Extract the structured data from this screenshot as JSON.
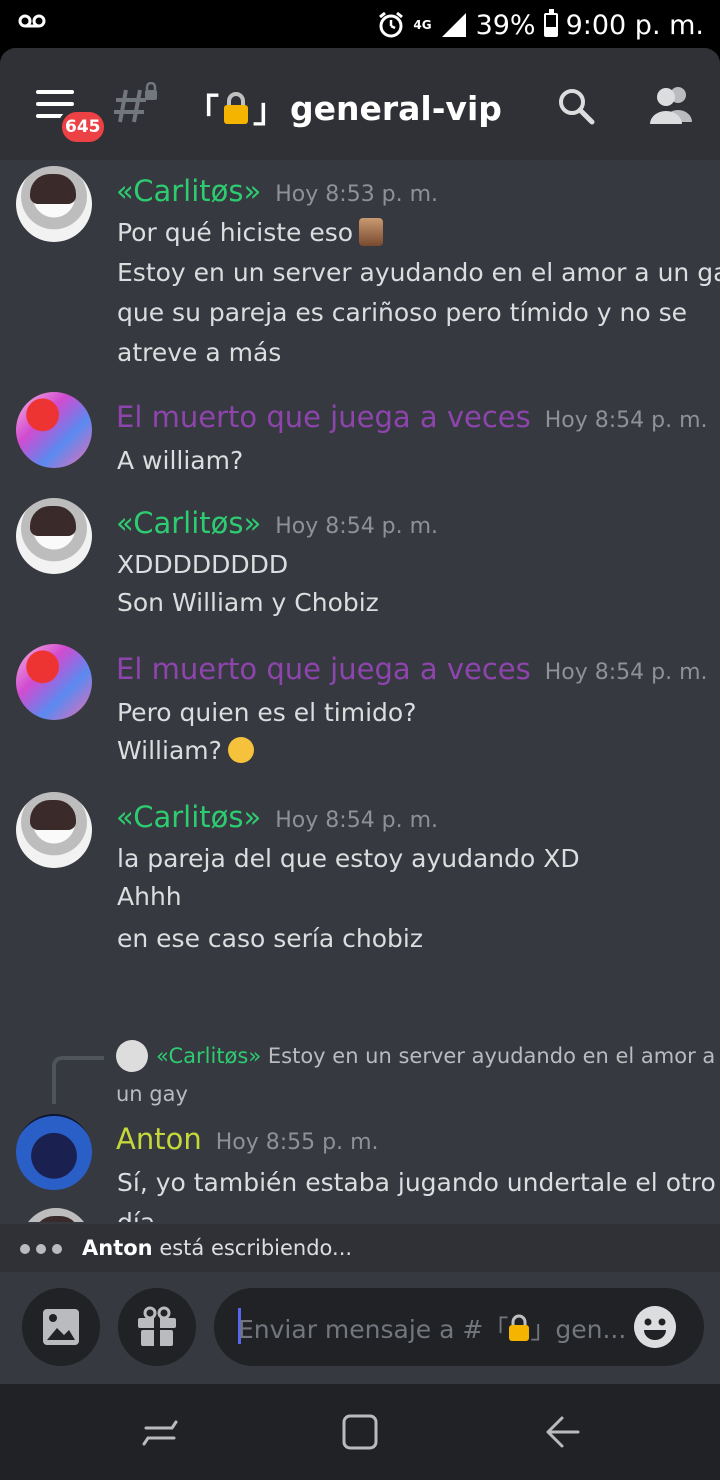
{
  "status": {
    "network": "4G",
    "battery": "39%",
    "time": "9:00 p. m."
  },
  "header": {
    "unread_count": "645",
    "channel_prefix": "「",
    "channel_suffix": "」",
    "channel_name": "general-vip"
  },
  "messages": [
    {
      "author": "«Carlitøs»",
      "time": "Hoy 8:53 p. m.",
      "lines": [
        "Por qué hiciste eso",
        "Estoy en un server ayudando en el amor a un gay",
        "que su pareja es cariñoso pero tímido y no se",
        "atreve a más"
      ]
    },
    {
      "author": "El muerto que juega a veces",
      "time": "Hoy 8:54 p. m.",
      "lines": [
        "A william?"
      ]
    },
    {
      "author": "«Carlitøs»",
      "time": "Hoy 8:54 p. m.",
      "lines": [
        "XDDDDDDDD",
        "Son William y Chobiz"
      ]
    },
    {
      "author": "El muerto que juega a veces",
      "time": "Hoy 8:54 p. m.",
      "lines": [
        "Pero quien es el timido?",
        "William?"
      ]
    },
    {
      "author": "«Carlitøs»",
      "time": "Hoy 8:54 p. m.",
      "lines": [
        "la pareja del que estoy ayudando XD",
        "Ahhh",
        "en ese caso sería chobiz"
      ]
    },
    {
      "reply_author": "«Carlitøs»",
      "reply_text_1": "Estoy en un server ayudando en el amor a",
      "reply_text_2": "un gay",
      "author": "Anton",
      "time": "Hoy 8:55 p. m.",
      "lines": [
        "Sí, yo también estaba jugando undertale el otro",
        "día"
      ]
    }
  ],
  "typing": {
    "user": "Anton",
    "text": "está escribiendo..."
  },
  "composer": {
    "placeholder_prefix": "Enviar mensaje a #「",
    "placeholder_suffix": "」gen..."
  },
  "colors": {
    "carlitos": "#2ecc71",
    "muerto": "#8e44ad",
    "anton": "#c5d83a",
    "badge": "#ed4245"
  }
}
